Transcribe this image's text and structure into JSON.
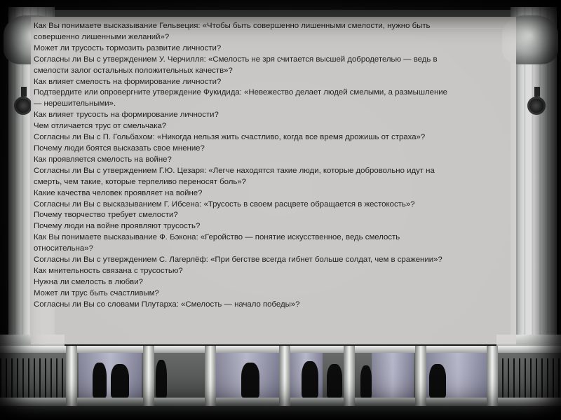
{
  "questions": [
    "Как Вы понимаете высказывание Гельвеция: «Чтобы быть совершенно лишенными смелости, нужно быть",
    "совершенно лишенными желаний»?",
    "Может ли трусость тормозить развитие личности?",
    "Согласны ли Вы с утверждением У. Черчилля: «Смелость не зря считается высшей добродетелью — ведь в",
    "смелости залог остальных положительных качеств»?",
    "Как влияет смелость на формирование личности?",
    "Подтвердите или опровергните утверждение Фукидида: «Невежество делает людей смелыми, а размышление",
    "— нерешительными».",
    "Как влияет трусость на формирование личности?",
    "Чем отличается трус от смельчака?",
    "Согласны ли Вы с П. Гольбахом: «Никогда нельзя жить счастливо, когда все время дрожишь от страха»?",
    "Почему люди боятся высказать свое мнение?",
    "Как проявляется смелость на войне?",
    "Согласны ли Вы с утверждением Г.Ю. Цезаря: «Легче находятся такие люди, которые добровольно идут на",
    "смерть, чем такие, которые терпеливо переносят боль»?",
    "Какие качества человек проявляет на войне?",
    "Согласны ли Вы с высказыванием Г. Ибсена: «Трусость в своем расцвете обращается в жестокость»?",
    "Почему творчество требует смелости?",
    "Почему люди на войне проявляют трусость?",
    "Как Вы понимаете высказывание Ф. Бэкона: «Геройство — понятие искусственное, ведь смелость",
    "относительна»?",
    "Согласны ли Вы с утверждением С. Лагерлёф: «При бегстве всегда гибнет больше солдат, чем в сражении»?",
    "Как мнительность связана с трусостью?",
    "Нужна ли смелость в любви?",
    "Может ли трус быть счастливым?",
    "Согласны ли Вы со словами Плутарха: «Смелость — начало победы»?"
  ],
  "colors": {
    "panel": "#d6d4d2",
    "text": "#1f1f1f",
    "background": "#1a1a1a"
  }
}
